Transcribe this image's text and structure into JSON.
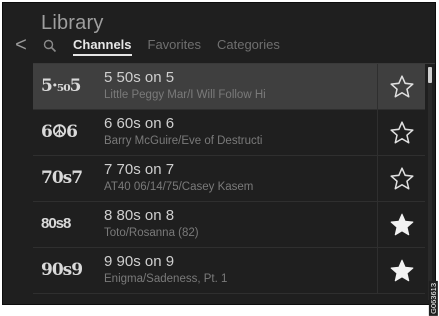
{
  "header": {
    "back_glyph": "<",
    "title": "Library",
    "tabs": [
      {
        "label": "Channels",
        "active": true
      },
      {
        "label": "Favorites",
        "active": false
      },
      {
        "label": "Categories",
        "active": false
      }
    ]
  },
  "channels": [
    {
      "logo": "5·₅₀5",
      "name": "5 50s on 5",
      "info": "Little Peggy Mar/I Will Follow Hi",
      "favorite": false,
      "selected": true
    },
    {
      "logo": "6☮6",
      "name": "6 60s on 6",
      "info": "Barry McGuire/Eve of Destructi",
      "favorite": false,
      "selected": false
    },
    {
      "logo": "70s7",
      "name": "7 70s on 7",
      "info": "AT40 06/14/75/Casey Kasem",
      "favorite": false,
      "selected": false
    },
    {
      "logo": "80s8",
      "name": "8 80s on 8",
      "info": "Toto/Rosanna (82)",
      "favorite": true,
      "selected": false
    },
    {
      "logo": "90s9",
      "name": "9 90s on 9",
      "info": "Enigma/Sadeness, Pt. 1",
      "favorite": true,
      "selected": false
    }
  ],
  "figure_id": "G063613",
  "colors": {
    "background": "#1f1f1f",
    "selected_row": "#3f3f3f",
    "primary_text": "#cfcfcf",
    "secondary_text": "#7a7a7a"
  }
}
